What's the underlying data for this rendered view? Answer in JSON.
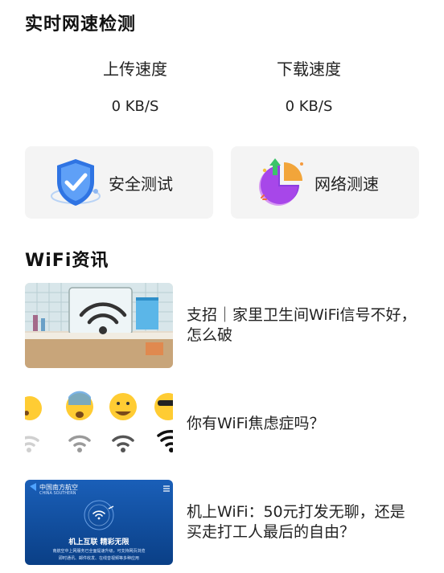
{
  "speed_section": {
    "title": "实时网速检测",
    "upload": {
      "label": "上传速度",
      "value": "0 KB/S"
    },
    "download": {
      "label": "下载速度",
      "value": "0 KB/S"
    }
  },
  "tools": [
    {
      "label": "安全测试",
      "icon": "shield-check-icon"
    },
    {
      "label": "网络测速",
      "icon": "speed-pie-icon"
    }
  ],
  "news_section": {
    "title": "WiFi资讯",
    "items": [
      {
        "text": "支招｜家里卫生间WiFi信号不好，怎么破"
      },
      {
        "text": "你有WiFi焦虑症吗？"
      },
      {
        "text": "机上WiFi：50元打发无聊，还是买走打工人最后的自由？",
        "thumb_brand": "中国南方航空",
        "thumb_brand_en": "CHINA SOUTHERN",
        "thumb_slogan": "机上互联 精彩无限",
        "thumb_desc_1": "南航空中上网服务已全面提速升级，可支持网页浏览",
        "thumb_desc_2": "即时通讯、邮件收发、在线音视频等多种应用"
      }
    ]
  },
  "colors": {
    "card_bg": "#f4f4f4",
    "airline_blue": "#0b4fa6"
  }
}
